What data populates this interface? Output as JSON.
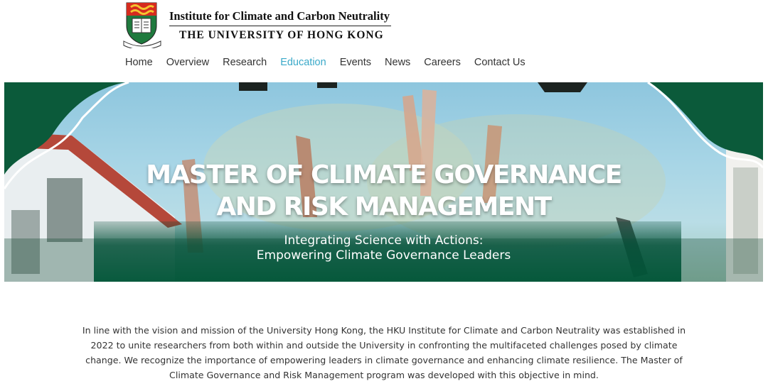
{
  "brand": {
    "institute": "Institute for Climate and Carbon Neutrality",
    "university": "THE UNIVERSITY OF HONG KONG"
  },
  "nav": {
    "items": [
      "Home",
      "Overview",
      "Research",
      "Education",
      "Events",
      "News",
      "Careers",
      "Contact Us"
    ],
    "active": "Education",
    "active_color": "#3aa9c9"
  },
  "hero": {
    "title_line1": "MASTER OF CLIMATE GOVERNANCE",
    "title_line2": "AND RISK MANAGEMENT",
    "subtitle_line1": "Integrating Science with Actions:",
    "subtitle_line2": "Empowering Climate Governance Leaders",
    "accent_color": "#0b5a3a"
  },
  "intro": {
    "text": "In line with the vision and mission of the University Hong Kong, the HKU Institute for Climate and Carbon Neutrality was established in 2022 to unite researchers from both within and outside the University in confronting the multifaceted challenges posed by climate change. We recognize the importance of empowering leaders in climate governance and enhancing climate resilience. The Master of Climate Governance and Risk Management program was developed with this objective in mind."
  }
}
